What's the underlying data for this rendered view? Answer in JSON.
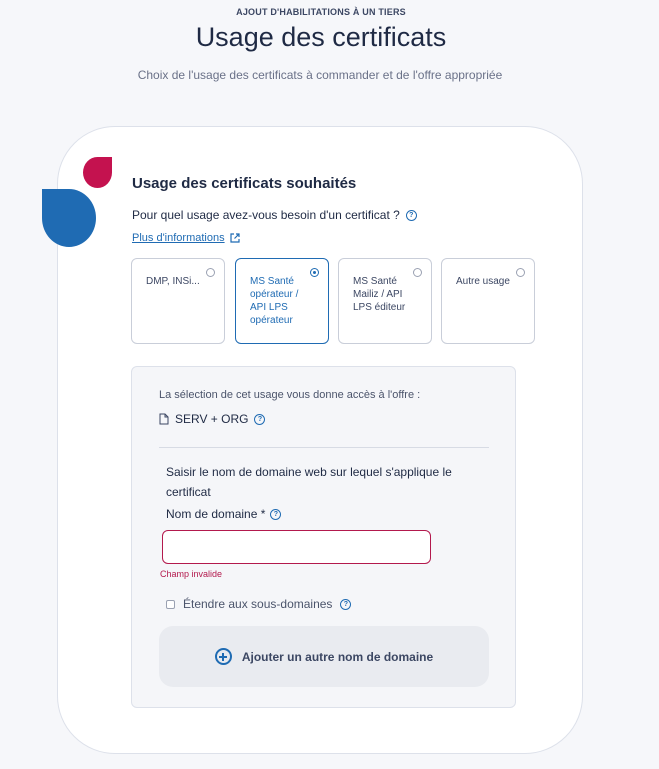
{
  "header": {
    "eyebrow": "AJOUT D'HABILITATIONS À UN TIERS",
    "title": "Usage des certificats",
    "subtitle": "Choix de l'usage des certificats à commander et de l'offre appropriée"
  },
  "section": {
    "title": "Usage des certificats souhaités",
    "question": "Pour quel usage avez-vous besoin d'un certificat ?",
    "more_info": "Plus d'informations",
    "options": [
      {
        "label": "DMP, INSi...",
        "selected": false
      },
      {
        "label": "MS Santé opérateur / API LPS opérateur",
        "selected": true
      },
      {
        "label": "MS Santé Mailiz / API LPS éditeur",
        "selected": false
      },
      {
        "label": "Autre usage",
        "selected": false
      }
    ]
  },
  "offer": {
    "text": "La sélection de cet usage vous donne accès à l'offre :",
    "name": "SERV + ORG"
  },
  "domain": {
    "heading": "Saisir le nom de domaine web sur lequel s'applique le certificat",
    "label": "Nom de domaine *",
    "value": "",
    "placeholder": "",
    "error": "Champ invalide",
    "subdomain_label": "Étendre aux sous-domaines",
    "add_button": "Ajouter un autre nom de domaine"
  },
  "colors": {
    "brand_blue": "#1f6bb3",
    "brand_red": "#c4124f",
    "error": "#b3194d"
  }
}
